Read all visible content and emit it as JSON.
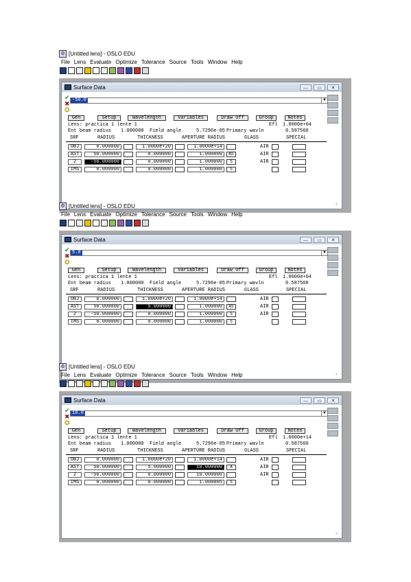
{
  "app": {
    "title": "[Untitled lens] - OSLO EDU",
    "menu": [
      "File",
      "Lens",
      "Evaluate",
      "Optimize",
      "Tolerance",
      "Source",
      "Tools",
      "Window",
      "Help"
    ]
  },
  "window": {
    "title": "Surface Data",
    "buttons": [
      "Gen",
      "Setup",
      "Wavelength",
      "Variables",
      "Draw Off",
      "Group",
      "Notes"
    ],
    "lens_line": "Lens: practica 1 lente 1",
    "efl_label": "Efl",
    "beam_line": "Ent beam radius",
    "field_label": "Field angle",
    "primary_label": "Primary wavln",
    "headers": [
      "SRF",
      "RADIUS",
      "THICKNESS",
      "APERTURE RADIUS",
      "GLASS",
      "SPECIAL"
    ]
  },
  "screens": [
    {
      "edit_value": "-50.0",
      "efl": "1.0000e+04",
      "ent_beam_radius": "1.000000",
      "field_angle": "5.7296e-05",
      "primary_wavln": "0.587560",
      "rows": [
        {
          "srf": "OBJ",
          "radius": "0.000000",
          "thickness": "1.0000e+20",
          "aperture": "1.0000e+14",
          "ap_flag": "",
          "glass": "AIR"
        },
        {
          "srf": "AST",
          "radius": "50.000000",
          "thickness": "0.000000",
          "aperture": "1.000000",
          "ap_flag": "AS",
          "glass": "AIR"
        },
        {
          "srf": "2",
          "radius": "-50.000000",
          "thickness": "0.000000",
          "aperture": "1.000000",
          "ap_flag": "S",
          "glass": "AIR"
        },
        {
          "srf": "IMS",
          "radius": "0.000000",
          "thickness": "0.000000",
          "aperture": "1.000000",
          "ap_flag": "S",
          "glass": ""
        }
      ],
      "highlight": {
        "row": 2,
        "col": "radius"
      }
    },
    {
      "edit_value": "5.0",
      "efl": "1.0000e+04",
      "ent_beam_radius": "1.000000",
      "field_angle": "5.7296e-05",
      "primary_wavln": "0.587560",
      "rows": [
        {
          "srf": "OBJ",
          "radius": "0.000000",
          "thickness": "1.0000e+20",
          "aperture": "1.0000e+14",
          "ap_flag": "",
          "glass": "AIR"
        },
        {
          "srf": "AST",
          "radius": "50.000000",
          "thickness": "5.000000",
          "aperture": "1.000000",
          "ap_flag": "AS",
          "glass": "AIR"
        },
        {
          "srf": "2",
          "radius": "-50.000000",
          "thickness": "0.000000",
          "aperture": "1.000000",
          "ap_flag": "S",
          "glass": "AIR"
        },
        {
          "srf": "IMS",
          "radius": "0.000000",
          "thickness": "0.000000",
          "aperture": "1.000000",
          "ap_flag": "S",
          "glass": ""
        }
      ],
      "highlight": {
        "row": 1,
        "col": "thickness"
      }
    },
    {
      "edit_value": "10.0",
      "efl": "1.0000e+14",
      "ent_beam_radius": "1.000000",
      "field_angle": "5.7296e-05",
      "primary_wavln": "0.587560",
      "rows": [
        {
          "srf": "OBJ",
          "radius": "0.000000",
          "thickness": "1.0000e+20",
          "aperture": "1.0000e+14",
          "ap_flag": "",
          "glass": "AIR"
        },
        {
          "srf": "AST",
          "radius": "50.000000",
          "thickness": "5.000000",
          "aperture": "10.000000",
          "ap_flag": "A",
          "glass": "AIR"
        },
        {
          "srf": "2",
          "radius": "-50.000000",
          "thickness": "0.000000",
          "aperture": "10.000000",
          "ap_flag": "",
          "glass": "AIR"
        },
        {
          "srf": "IMS",
          "radius": "0.000000",
          "thickness": "0.000000",
          "aperture": "1.000005",
          "ap_flag": "S",
          "glass": ""
        }
      ],
      "highlight": {
        "row": 1,
        "col": "aperture"
      }
    }
  ]
}
